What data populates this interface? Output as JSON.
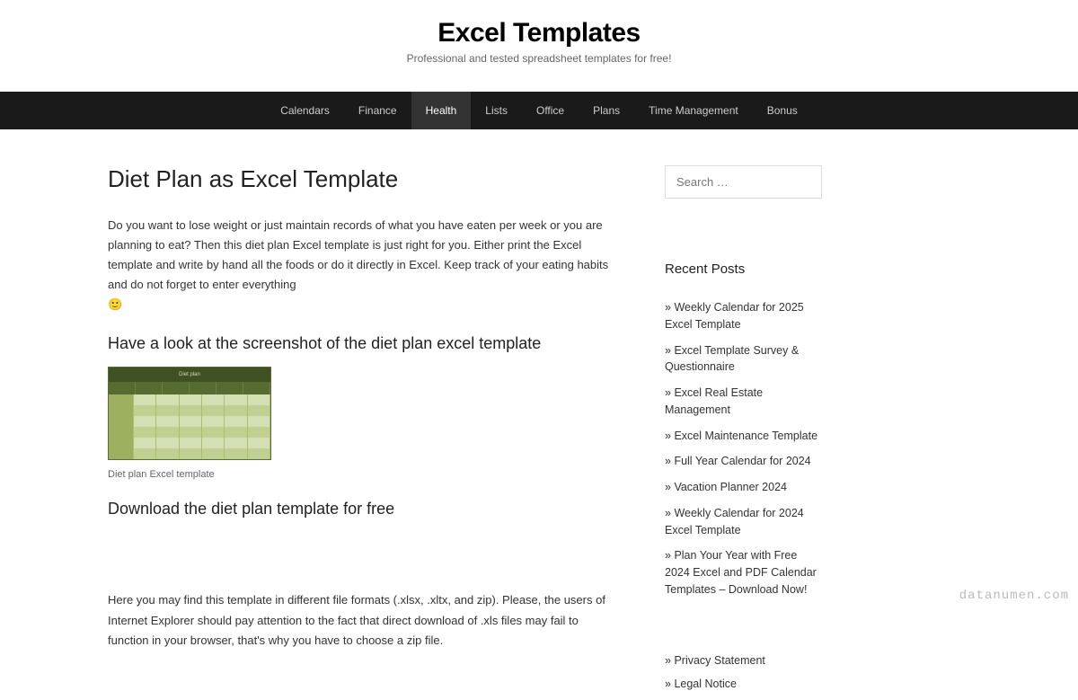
{
  "site": {
    "title": "Excel Templates",
    "tagline": "Professional and tested spreadsheet templates for free!"
  },
  "nav": [
    "Calendars",
    "Finance",
    "Health",
    "Lists",
    "Office",
    "Plans",
    "Time Management",
    "Bonus"
  ],
  "nav_active_index": 2,
  "post": {
    "title": "Diet Plan as Excel Template",
    "intro": "Do you want to lose weight or just maintain records of what you have eaten per week or you are planning to eat? Then this diet plan Excel template is just right for you. Either print the Excel template and write by hand all the foods or do it directly in Excel. Keep track of your eating habits and do not forget to enter everything",
    "emoji": "🙂",
    "h2a": "Have a look at the screenshot of the diet plan excel template",
    "caption": "Diet plan Excel template",
    "h2b": "Download the diet plan template for free",
    "para2": "Here you may find this template in different file formats (.xlsx, .xltx, and zip). Please, the users of Internet Explorer should pay attention to the fact that direct download of .xls files may fail to function in your browser, that's why you have to choose a zip file."
  },
  "sidebar": {
    "search_placeholder": "Search …",
    "recent_title": "Recent Posts",
    "recent_posts": [
      "Weekly Calendar for 2025 Excel Template",
      "Excel Template Survey & Questionnaire",
      "Excel Real Estate Management",
      "Excel Maintenance Template",
      "Full Year Calendar for 2024",
      "Vacation Planner 2024",
      "Weekly Calendar for 2024 Excel Template",
      "Plan Your Year with Free 2024 Excel and PDF Calendar Templates – Download Now!"
    ],
    "footer_links": [
      "Privacy Statement",
      "Legal Notice"
    ]
  },
  "watermark": "datanumen.com",
  "screenshot_header": "Diet plan"
}
